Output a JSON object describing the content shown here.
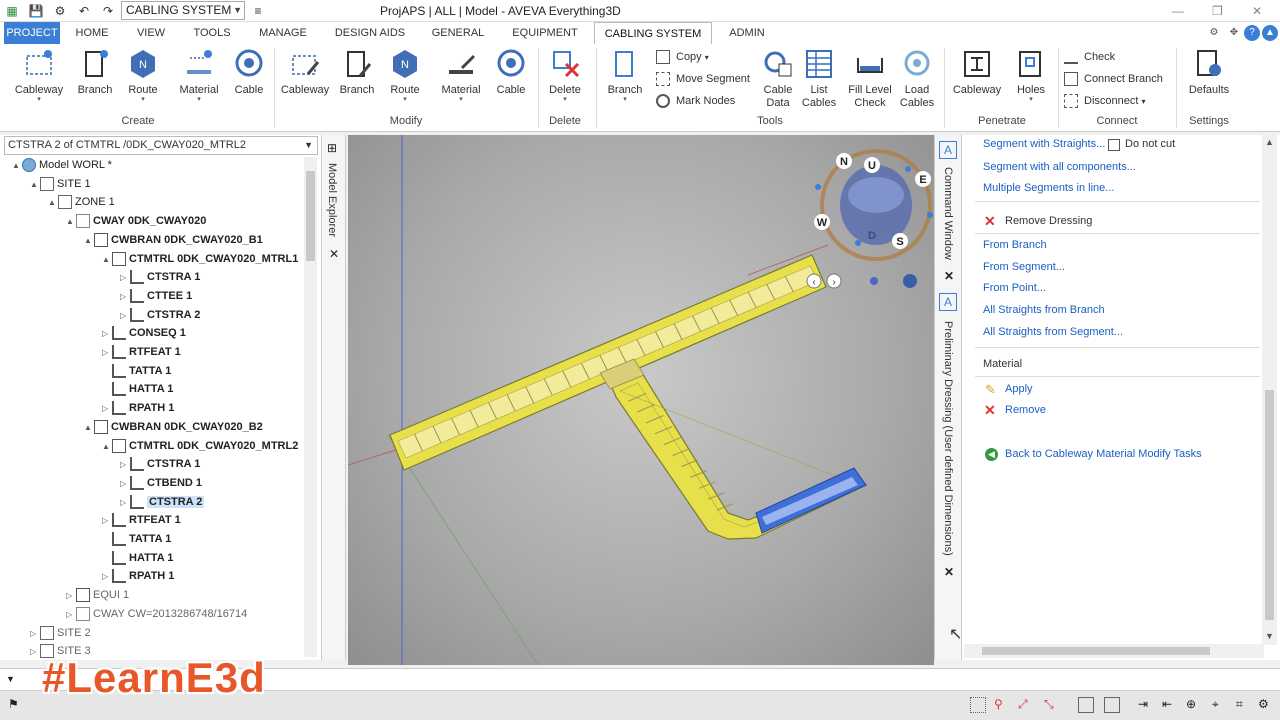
{
  "titlebar": {
    "combo_value": "CABLING SYSTEM",
    "title": "ProjAPS | ALL | Model - AVEVA Everything3D"
  },
  "tabs": [
    "PROJECT",
    "HOME",
    "VIEW",
    "TOOLS",
    "MANAGE",
    "DESIGN AIDS",
    "GENERAL",
    "EQUIPMENT",
    "CABLING SYSTEM",
    "ADMIN"
  ],
  "tabs_active": "CABLING SYSTEM",
  "ribbon": {
    "create": {
      "label": "Create",
      "buttons": [
        "Cableway",
        "Branch",
        "Route",
        "Material",
        "Cable"
      ]
    },
    "modify": {
      "label": "Modify",
      "buttons": [
        "Cableway",
        "Branch",
        "Route",
        "Material",
        "Cable"
      ]
    },
    "delete": {
      "label": "Delete",
      "buttons": [
        "Delete"
      ]
    },
    "tools": {
      "label": "Tools",
      "branch": "Branch",
      "copy": "Copy",
      "move_segment": "Move Segment",
      "mark_nodes": "Mark Nodes",
      "cable_data": [
        "Cable",
        "Data"
      ],
      "list_cables": [
        "List",
        "Cables"
      ],
      "fill_level": [
        "Fill Level",
        "Check"
      ],
      "load_cables": [
        "Load",
        "Cables"
      ]
    },
    "penetrate": {
      "label": "Penetrate",
      "buttons": [
        "Cableway",
        "Holes"
      ]
    },
    "connect": {
      "label": "Connect",
      "check": "Check",
      "connect_branch": "Connect Branch",
      "disconnect": "Disconnect"
    },
    "settings": {
      "label": "Settings",
      "defaults": "Defaults"
    }
  },
  "explorer": {
    "combo": "CTSTRA 2 of CTMTRL /0DK_CWAY020_MTRL2",
    "side_label": "Model Explorer",
    "tree": [
      {
        "label": "Model WORL *",
        "bold": false
      },
      {
        "label": "SITE 1",
        "bold": false
      },
      {
        "label": "ZONE 1",
        "bold": false
      },
      {
        "label": "CWAY 0DK_CWAY020",
        "bold": true
      },
      {
        "label": "CWBRAN 0DK_CWAY020_B1",
        "bold": true
      },
      {
        "label": "CTMTRL 0DK_CWAY020_MTRL1",
        "bold": true
      },
      {
        "label": "CTSTRA 1",
        "bold": true
      },
      {
        "label": "CTTEE 1",
        "bold": true
      },
      {
        "label": "CTSTRA 2",
        "bold": true
      },
      {
        "label": "CONSEQ 1",
        "bold": true
      },
      {
        "label": "RTFEAT 1",
        "bold": true
      },
      {
        "label": "TATTA 1",
        "bold": true
      },
      {
        "label": "HATTA 1",
        "bold": true
      },
      {
        "label": "RPATH 1",
        "bold": true
      },
      {
        "label": "CWBRAN 0DK_CWAY020_B2",
        "bold": true
      },
      {
        "label": "CTMTRL 0DK_CWAY020_MTRL2",
        "bold": true
      },
      {
        "label": "CTSTRA 1",
        "bold": true
      },
      {
        "label": "CTBEND 1",
        "bold": true
      },
      {
        "label": "CTSTRA 2",
        "bold": true
      },
      {
        "label": "RTFEAT 1",
        "bold": true
      },
      {
        "label": "TATTA 1",
        "bold": true
      },
      {
        "label": "HATTA 1",
        "bold": true
      },
      {
        "label": "RPATH 1",
        "bold": true
      },
      {
        "label": "EQUI 1",
        "bold": false
      },
      {
        "label": "CWAY CW=2013286748/16714",
        "bold": false
      },
      {
        "label": "SITE 2",
        "bold": false
      },
      {
        "label": "SITE 3",
        "bold": false
      }
    ]
  },
  "compass": {
    "n": "N",
    "u": "U",
    "e": "E",
    "w": "W",
    "d": "D",
    "s": "S"
  },
  "dock": {
    "command_window": "Command Window",
    "preliminary": "Preliminary Dressing (User defined Dimensions)"
  },
  "panel": {
    "segment_with_straights": "Segment with Straights...",
    "do_not_cut": "Do not cut",
    "segment_all": "Segment with all components...",
    "multiple_segments": "Multiple Segments in line...",
    "remove_dressing": "Remove Dressing",
    "from_branch": "From Branch",
    "from_segment": "From Segment...",
    "from_point": "From Point...",
    "all_straights_branch": "All Straights from Branch",
    "all_straights_segment": "All Straights from Segment...",
    "material_heading": "Material",
    "apply": "Apply",
    "remove": "Remove",
    "back": "Back to Cableway Material Modify Tasks"
  },
  "hashtag": "#LearnE3d",
  "colors": {
    "accent": "#3a7fd5",
    "link": "#1a5fc4",
    "tray": "#e8e04a",
    "tray_blue": "#3f6fd8",
    "hashtag": "#e8572a"
  }
}
